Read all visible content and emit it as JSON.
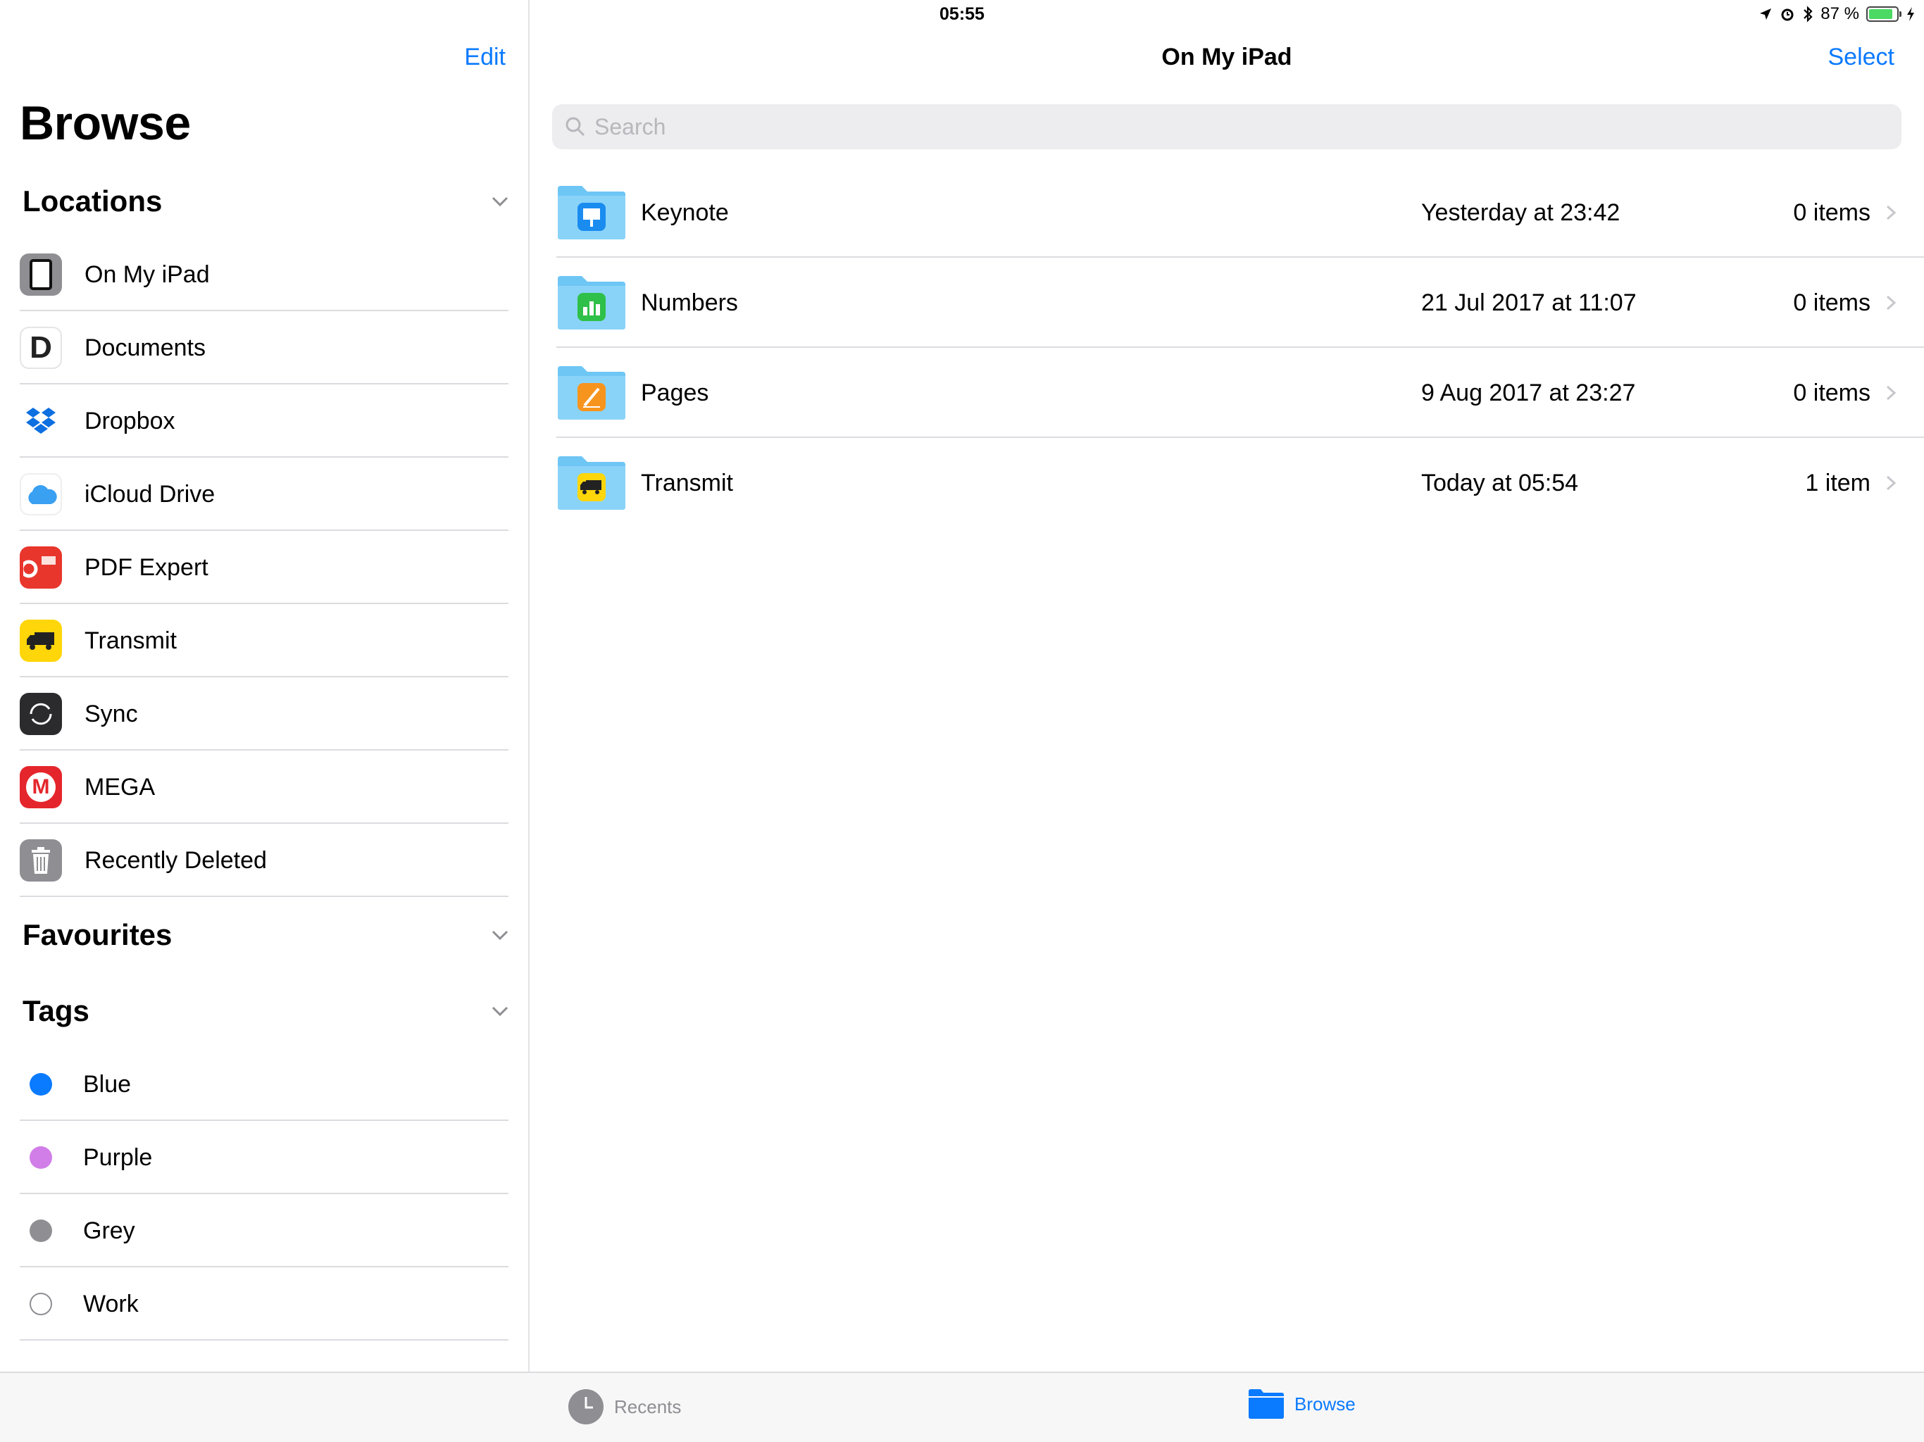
{
  "status_bar": {
    "device": "iPad",
    "time": "05:55",
    "battery": "87 %",
    "battery_level": 0.87
  },
  "sidebar": {
    "edit_label": "Edit",
    "title": "Browse",
    "locations": {
      "heading": "Locations",
      "items": [
        {
          "label": "On My iPad",
          "icon": "ipad-icon"
        },
        {
          "label": "Documents",
          "icon": "documents-app-icon"
        },
        {
          "label": "Dropbox",
          "icon": "dropbox-icon"
        },
        {
          "label": "iCloud Drive",
          "icon": "icloud-icon"
        },
        {
          "label": "PDF Expert",
          "icon": "pdf-expert-icon"
        },
        {
          "label": "Transmit",
          "icon": "transmit-icon"
        },
        {
          "label": "Sync",
          "icon": "sync-icon"
        },
        {
          "label": "MEGA",
          "icon": "mega-icon"
        },
        {
          "label": "Recently Deleted",
          "icon": "trash-icon"
        }
      ]
    },
    "favourites": {
      "heading": "Favourites"
    },
    "tags": {
      "heading": "Tags",
      "items": [
        {
          "label": "Blue",
          "color": "#0a7aff"
        },
        {
          "label": "Purple",
          "color": "#d17ee8"
        },
        {
          "label": "Grey",
          "color": "#8e8e93"
        },
        {
          "label": "Work",
          "color": "#ffffff"
        }
      ]
    }
  },
  "main": {
    "title": "On My iPad",
    "select_label": "Select",
    "search_placeholder": "Search",
    "files": [
      {
        "name": "Keynote",
        "date": "Yesterday at 23:42",
        "count": "0 items",
        "icon": "keynote-folder-icon"
      },
      {
        "name": "Numbers",
        "date": "21 Jul 2017 at 11:07",
        "count": "0 items",
        "icon": "numbers-folder-icon"
      },
      {
        "name": "Pages",
        "date": "9 Aug 2017 at 23:27",
        "count": "0 items",
        "icon": "pages-folder-icon"
      },
      {
        "name": "Transmit",
        "date": "Today at 05:54",
        "count": "1 item",
        "icon": "transmit-folder-icon"
      }
    ]
  },
  "tabbar": {
    "recents_label": "Recents",
    "browse_label": "Browse"
  },
  "colors": {
    "accent": "#0a7aff",
    "separator": "#dcdce0"
  }
}
